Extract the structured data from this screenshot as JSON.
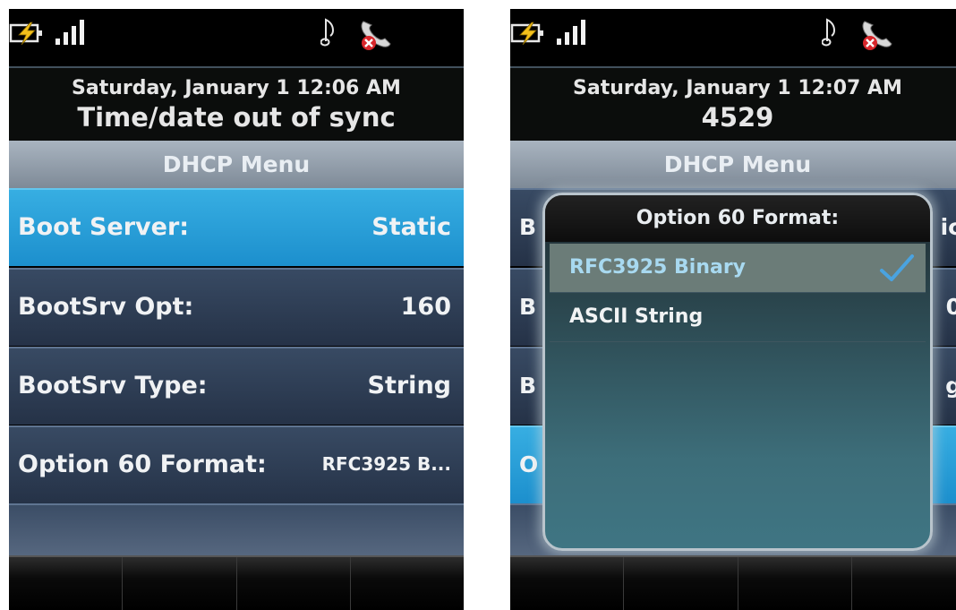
{
  "screen1": {
    "status": {
      "icons": [
        "battery-charging-icon",
        "signal-strength-icon",
        "music-note-icon",
        "call-end-icon"
      ]
    },
    "infobar": {
      "date": "Saturday, January 1 12:06 AM",
      "line2": "Time/date out of sync"
    },
    "menu_title": "DHCP Menu",
    "rows": [
      {
        "label": "Boot Server:",
        "value": "Static"
      },
      {
        "label": "BootSrv Opt:",
        "value": "160"
      },
      {
        "label": "BootSrv Type:",
        "value": "String"
      },
      {
        "label": "Option 60 Format:",
        "value": "RFC3925 B..."
      }
    ]
  },
  "screen2": {
    "status": {
      "icons": [
        "battery-charging-icon",
        "signal-strength-icon",
        "music-note-icon",
        "call-end-icon"
      ]
    },
    "infobar": {
      "date": "Saturday, January 1 12:07 AM",
      "line2": "4529"
    },
    "menu_title": "DHCP Menu",
    "behind": {
      "r1_left": "B",
      "r1_right": "ic",
      "r2_left": "B",
      "r2_right": "0",
      "r3_left": "B",
      "r3_right": "g",
      "r4_left": "O"
    },
    "popup": {
      "title": "Option 60 Format:",
      "options": [
        {
          "label": "RFC3925 Binary",
          "selected": true
        },
        {
          "label": "ASCII String",
          "selected": false
        }
      ]
    }
  },
  "colors": {
    "selected_row": "#1c8fcd",
    "row_bg": "#2b3a52",
    "check": "#4aa3e0",
    "charge": "#f3c01b"
  }
}
